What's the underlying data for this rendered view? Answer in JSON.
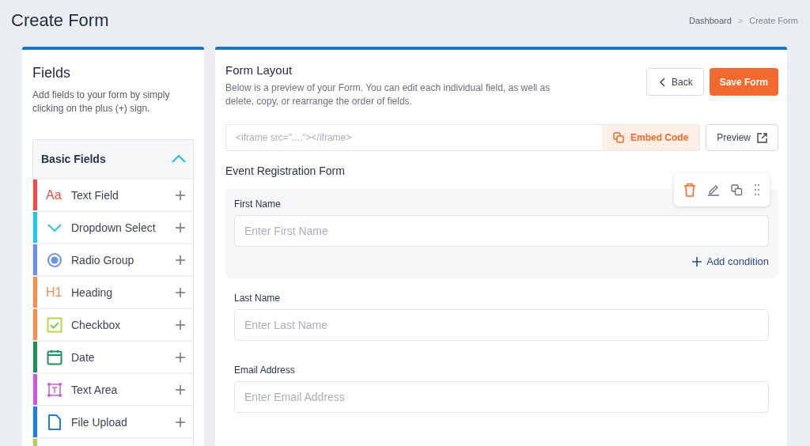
{
  "page_title": "Create Form",
  "breadcrumb": [
    "Dashboard",
    "Create Form"
  ],
  "breadcrumb_separator": ">",
  "fields_panel": {
    "title": "Fields",
    "description": "Add fields to your form by simply clicking on the plus (+) sign.",
    "section": {
      "title": "Basic Fields",
      "expanded": true,
      "items": [
        {
          "kind": "text",
          "glyph": "Aa",
          "label": "Text Field",
          "color": "#f44b42"
        },
        {
          "kind": "dropdown",
          "label": "Dropdown Select",
          "color": "#1ecbe6"
        },
        {
          "kind": "radio",
          "label": "Radio Group",
          "color": "#6b8ef0"
        },
        {
          "kind": "heading",
          "glyph": "H1",
          "label": "Heading",
          "color": "#fb8c4d"
        },
        {
          "kind": "checkbox",
          "label": "Checkbox",
          "color": "#fb8c4d"
        },
        {
          "kind": "date",
          "label": "Date",
          "color": "#1e8e5a"
        },
        {
          "kind": "textarea",
          "label": "Text Area",
          "color": "#c660d6"
        },
        {
          "kind": "file",
          "label": "File Upload",
          "color": "#1a7fe8"
        },
        {
          "kind": "cut",
          "color": "#b9c94e"
        }
      ]
    }
  },
  "form_layout": {
    "title": "Form Layout",
    "description": "Below is a preview of your Form. You can edit each individual field, as well as delete, copy, or rearrange the order of fields.",
    "back_button": "Back",
    "save_button": "Save Form",
    "embed_placeholder": "<iframe src=\"....\"></iframe>",
    "embed_button": "Embed Code",
    "preview_button": "Preview",
    "form_name": "Event Registration Form",
    "fields": [
      {
        "label": "First Name",
        "placeholder": "Enter First Name",
        "selected": true,
        "condition_link": "Add condition"
      },
      {
        "label": "Last Name",
        "placeholder": "Enter Last Name",
        "selected": false
      },
      {
        "label": "Email Address",
        "placeholder": "Enter Email Address",
        "selected": false
      }
    ]
  }
}
